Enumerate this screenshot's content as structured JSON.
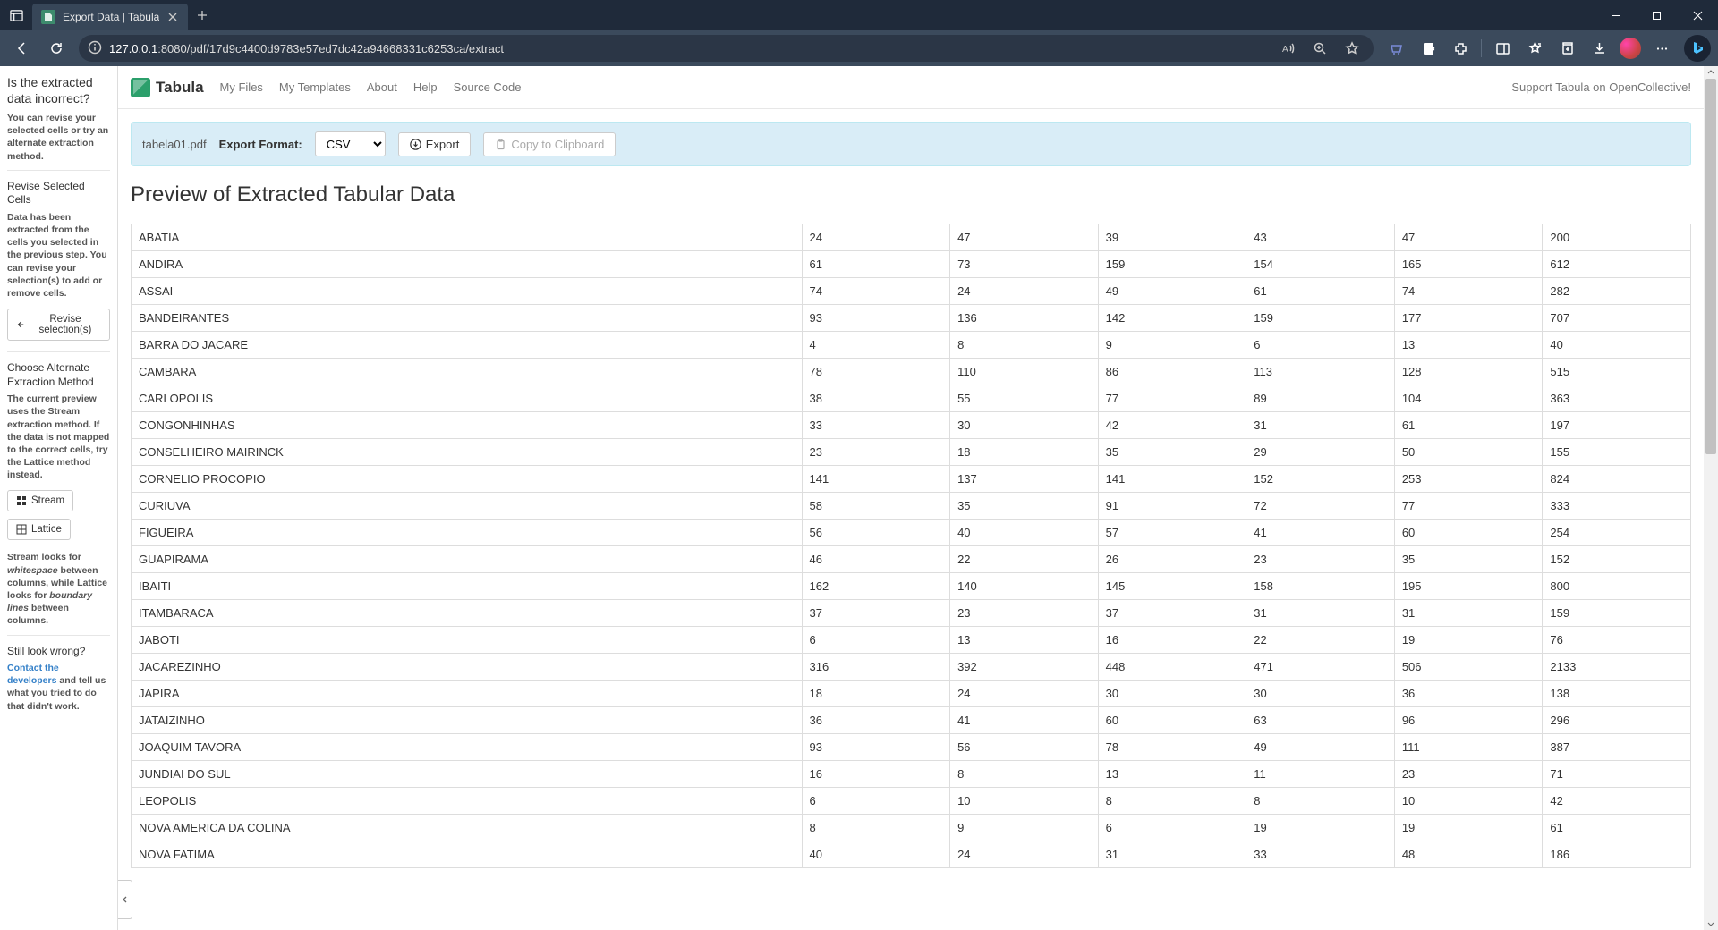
{
  "browser": {
    "tab_title": "Export Data | Tabula",
    "url_host": "127.0.0.1",
    "url_rest": ":8080/pdf/17d9c4400d9783e57ed7dc42a94668331c6253ca/extract"
  },
  "topnav": {
    "brand": "Tabula",
    "links": [
      "My Files",
      "My Templates",
      "About",
      "Help",
      "Source Code"
    ],
    "donate": "Support Tabula on OpenCollective!"
  },
  "actionbar": {
    "filename": "tabela01.pdf",
    "format_label": "Export Format:",
    "format_value": "CSV",
    "export_btn": "Export",
    "clipboard_btn": "Copy to Clipboard"
  },
  "sidebar": {
    "h1": "Is the extracted data incorrect?",
    "p1a": "You can revise your selected cells or try an alternate extraction method.",
    "h2": "Revise Selected Cells",
    "p2": "Data has been extracted from the cells you selected in the previous step. You can revise your selection(s) to add or remove cells.",
    "btn_revise": "Revise selection(s)",
    "h3": "Choose Alternate Extraction Method",
    "p3_pre": "The current preview uses the ",
    "p3_b1": "Stream",
    "p3_mid": " extraction method. If the data is not mapped to the correct cells, try the ",
    "p3_b2": "Lattice",
    "p3_post": " method instead.",
    "btn_stream": "Stream",
    "btn_lattice": "Lattice",
    "p4_pre": "Stream looks for ",
    "p4_i1": "whitespace",
    "p4_mid": " between columns, while Lattice looks for ",
    "p4_i2": "boundary lines",
    "p4_post": " between columns.",
    "h4": "Still look wrong?",
    "p5_link": "Contact the developers",
    "p5_rest": " and tell us what you tried to do that didn't work."
  },
  "main": {
    "title": "Preview of Extracted Tabular Data"
  },
  "table": {
    "rows": [
      {
        "name": "ABATIA",
        "c": [
          "24",
          "47",
          "39",
          "43",
          "47",
          "200"
        ]
      },
      {
        "name": "ANDIRA",
        "c": [
          "61",
          "73",
          "159",
          "154",
          "165",
          "612"
        ]
      },
      {
        "name": "ASSAI",
        "c": [
          "74",
          "24",
          "49",
          "61",
          "74",
          "282"
        ]
      },
      {
        "name": "BANDEIRANTES",
        "c": [
          "93",
          "136",
          "142",
          "159",
          "177",
          "707"
        ]
      },
      {
        "name": "BARRA DO JACARE",
        "c": [
          "4",
          "8",
          "9",
          "6",
          "13",
          "40"
        ]
      },
      {
        "name": "CAMBARA",
        "c": [
          "78",
          "110",
          "86",
          "113",
          "128",
          "515"
        ]
      },
      {
        "name": "CARLOPOLIS",
        "c": [
          "38",
          "55",
          "77",
          "89",
          "104",
          "363"
        ]
      },
      {
        "name": "CONGONHINHAS",
        "c": [
          "33",
          "30",
          "42",
          "31",
          "61",
          "197"
        ]
      },
      {
        "name": "CONSELHEIRO MAIRINCK",
        "c": [
          "23",
          "18",
          "35",
          "29",
          "50",
          "155"
        ]
      },
      {
        "name": "CORNELIO PROCOPIO",
        "c": [
          "141",
          "137",
          "141",
          "152",
          "253",
          "824"
        ]
      },
      {
        "name": "CURIUVA",
        "c": [
          "58",
          "35",
          "91",
          "72",
          "77",
          "333"
        ]
      },
      {
        "name": "FIGUEIRA",
        "c": [
          "56",
          "40",
          "57",
          "41",
          "60",
          "254"
        ]
      },
      {
        "name": "GUAPIRAMA",
        "c": [
          "46",
          "22",
          "26",
          "23",
          "35",
          "152"
        ]
      },
      {
        "name": "IBAITI",
        "c": [
          "162",
          "140",
          "145",
          "158",
          "195",
          "800"
        ]
      },
      {
        "name": "ITAMBARACA",
        "c": [
          "37",
          "23",
          "37",
          "31",
          "31",
          "159"
        ]
      },
      {
        "name": "JABOTI",
        "c": [
          "6",
          "13",
          "16",
          "22",
          "19",
          "76"
        ]
      },
      {
        "name": "JACAREZINHO",
        "c": [
          "316",
          "392",
          "448",
          "471",
          "506",
          "2133"
        ]
      },
      {
        "name": "JAPIRA",
        "c": [
          "18",
          "24",
          "30",
          "30",
          "36",
          "138"
        ]
      },
      {
        "name": "JATAIZINHO",
        "c": [
          "36",
          "41",
          "60",
          "63",
          "96",
          "296"
        ]
      },
      {
        "name": "JOAQUIM TAVORA",
        "c": [
          "93",
          "56",
          "78",
          "49",
          "111",
          "387"
        ]
      },
      {
        "name": "JUNDIAI DO SUL",
        "c": [
          "16",
          "8",
          "13",
          "11",
          "23",
          "71"
        ]
      },
      {
        "name": "LEOPOLIS",
        "c": [
          "6",
          "10",
          "8",
          "8",
          "10",
          "42"
        ]
      },
      {
        "name": "NOVA AMERICA DA COLINA",
        "c": [
          "8",
          "9",
          "6",
          "19",
          "19",
          "61"
        ]
      },
      {
        "name": "NOVA FATIMA",
        "c": [
          "40",
          "24",
          "31",
          "33",
          "48",
          "186"
        ]
      }
    ]
  }
}
